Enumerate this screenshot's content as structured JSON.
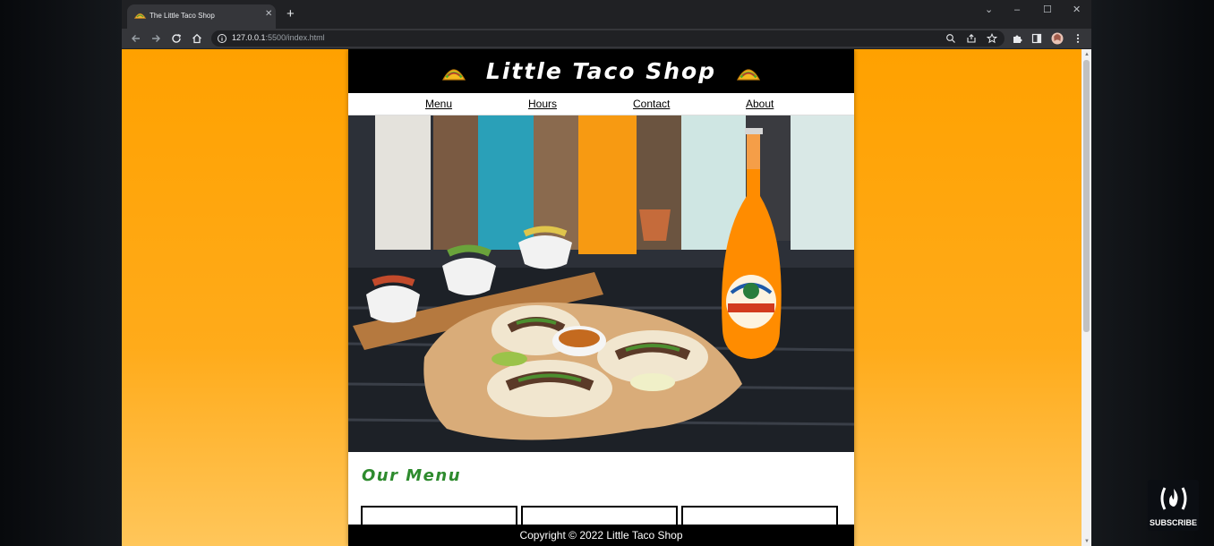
{
  "browser": {
    "tab_title": "The Little Taco Shop",
    "tab_close": "✕",
    "new_tab": "+",
    "url_host": "127.0.0.1",
    "url_rest": ":5500/index.html",
    "window_controls": {
      "dropdown": "⌄",
      "minimize": "–",
      "maximize": "☐",
      "close": "✕"
    }
  },
  "site": {
    "title": "Little Taco Shop",
    "nav": [
      {
        "label": "Menu"
      },
      {
        "label": "Hours"
      },
      {
        "label": "Contact"
      },
      {
        "label": "About"
      }
    ],
    "menu_heading": "Our Menu",
    "footer": "Copyright © 2022 Little Taco Shop"
  },
  "overlay": {
    "subscribe_label": "SUBSCRIBE"
  },
  "colors": {
    "page_background": "#ffa100",
    "header_background": "#000000",
    "menu_heading": "#2e8b2e",
    "browser_frame": "#202124",
    "toolbar": "#35363a"
  },
  "icons": [
    "taco-icon",
    "back-arrow-icon",
    "forward-arrow-icon",
    "reload-icon",
    "home-icon",
    "info-icon",
    "zoom-icon",
    "share-icon",
    "star-icon",
    "extensions-icon",
    "sidebar-icon",
    "profile-avatar",
    "more-menu-icon"
  ]
}
